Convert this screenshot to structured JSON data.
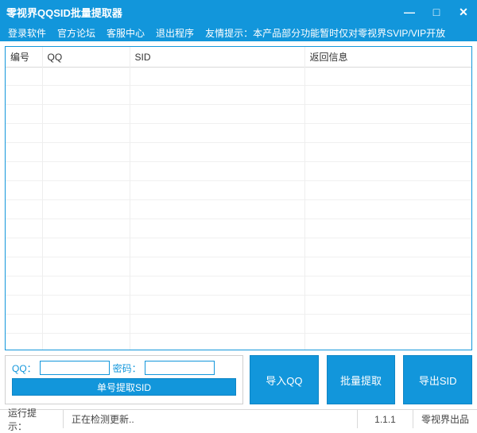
{
  "title": "零视界QQSID批量提取器",
  "window": {
    "min": "—",
    "max": "□",
    "close": "✕"
  },
  "menu": {
    "login": "登录软件",
    "forum": "官方论坛",
    "support": "客服中心",
    "exit": "退出程序",
    "hint": "友情提示：本产品部分功能暂时仅对零视界SVIP/VIP开放"
  },
  "table": {
    "headers": {
      "idx": "编号",
      "qq": "QQ",
      "sid": "SID",
      "ret": "返回信息"
    }
  },
  "form": {
    "qq_label": "QQ：",
    "pwd_label": "密码：",
    "single_btn": "单号提取SID"
  },
  "buttons": {
    "import_qq": "导入QQ",
    "batch": "批量提取",
    "export_sid": "导出SID"
  },
  "status": {
    "run_hint": "运行提示：",
    "checking": "正在检测更新..",
    "version": "1.1.1",
    "brand": "零视界出品"
  }
}
